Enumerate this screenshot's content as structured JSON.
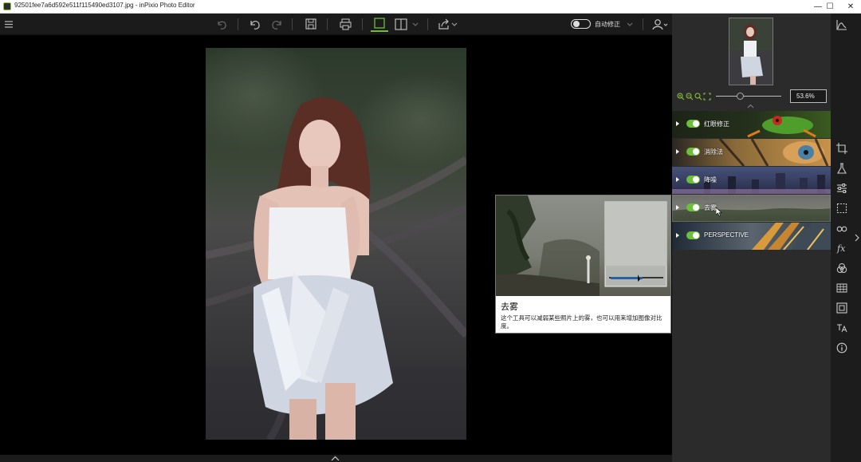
{
  "window": {
    "title": "92501fee7a6d592e511f115490ed3107.jpg - inPixio Photo Editor",
    "minimize": "—",
    "maximize": "☐",
    "close": "✕"
  },
  "toolbar": {
    "auto_fix_label": "自动修正"
  },
  "navigator": {
    "zoom_value": "53.6%"
  },
  "tools": [
    {
      "label": "红眼修正"
    },
    {
      "label": "消除法"
    },
    {
      "label": "降噪"
    },
    {
      "label": "去雾"
    },
    {
      "label": "PERSPECTIVE"
    }
  ],
  "tooltip": {
    "title": "去雾",
    "description": "这个工具可以减弱某些照片上的雾，也可以用来增加图像对比度。"
  },
  "colors": {
    "accent_green": "#6bbf3b",
    "panel_bg": "#2b2b2b",
    "toolbar_bg": "#1b1b1b"
  }
}
